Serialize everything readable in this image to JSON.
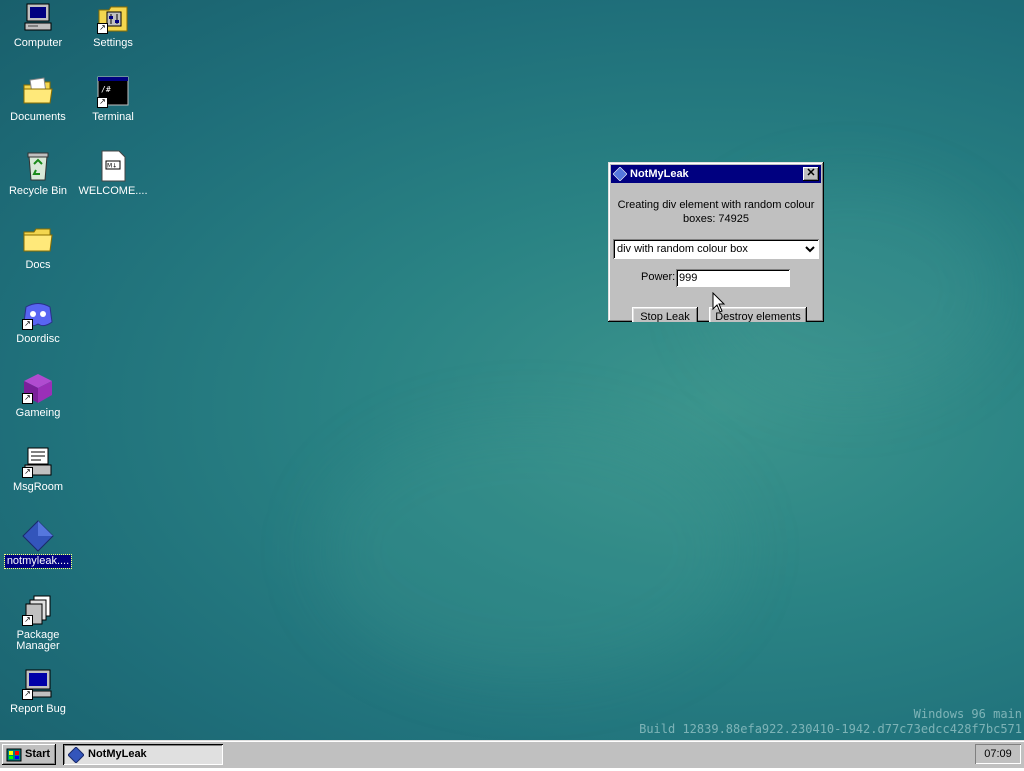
{
  "desktop": {
    "icons": [
      {
        "label": "Computer",
        "icon": "computer-icon"
      },
      {
        "label": "Settings",
        "icon": "settings-icon"
      },
      {
        "label": "Documents",
        "icon": "documents-folder-icon"
      },
      {
        "label": "Terminal",
        "icon": "terminal-icon"
      },
      {
        "label": "Recycle Bin",
        "icon": "recycle-bin-icon"
      },
      {
        "label": "WELCOME....",
        "icon": "welcome-doc-icon"
      },
      {
        "label": "Docs",
        "icon": "folder-icon"
      },
      {
        "label": "Doordisc",
        "icon": "doordisc-icon"
      },
      {
        "label": "Gameing",
        "icon": "gameing-cube-icon"
      },
      {
        "label": "MsgRoom",
        "icon": "msgroom-icon"
      },
      {
        "label": "notmyleak....",
        "icon": "notmyleak-diamond-icon",
        "selected": true
      },
      {
        "label": "Package Manager",
        "icon": "package-manager-icon"
      },
      {
        "label": "Report Bug",
        "icon": "report-bug-icon"
      }
    ],
    "watermark": {
      "line1": "Windows 96 main",
      "line2": "Build 12839.88efa922.230410-1942.d77c73edcc428f7bc571"
    }
  },
  "window": {
    "title": "NotMyLeak",
    "close_label": "✕",
    "message_line1": "Creating div element with random colour",
    "message_line2": "boxes: 74925",
    "select_value": "div with random colour box",
    "power_label": "Power:",
    "power_value": "999",
    "stop_label": "Stop Leak",
    "destroy_label": "Destroy elements"
  },
  "taskbar": {
    "start_label": "Start",
    "task_label": "NotMyLeak",
    "clock": "07:09"
  }
}
